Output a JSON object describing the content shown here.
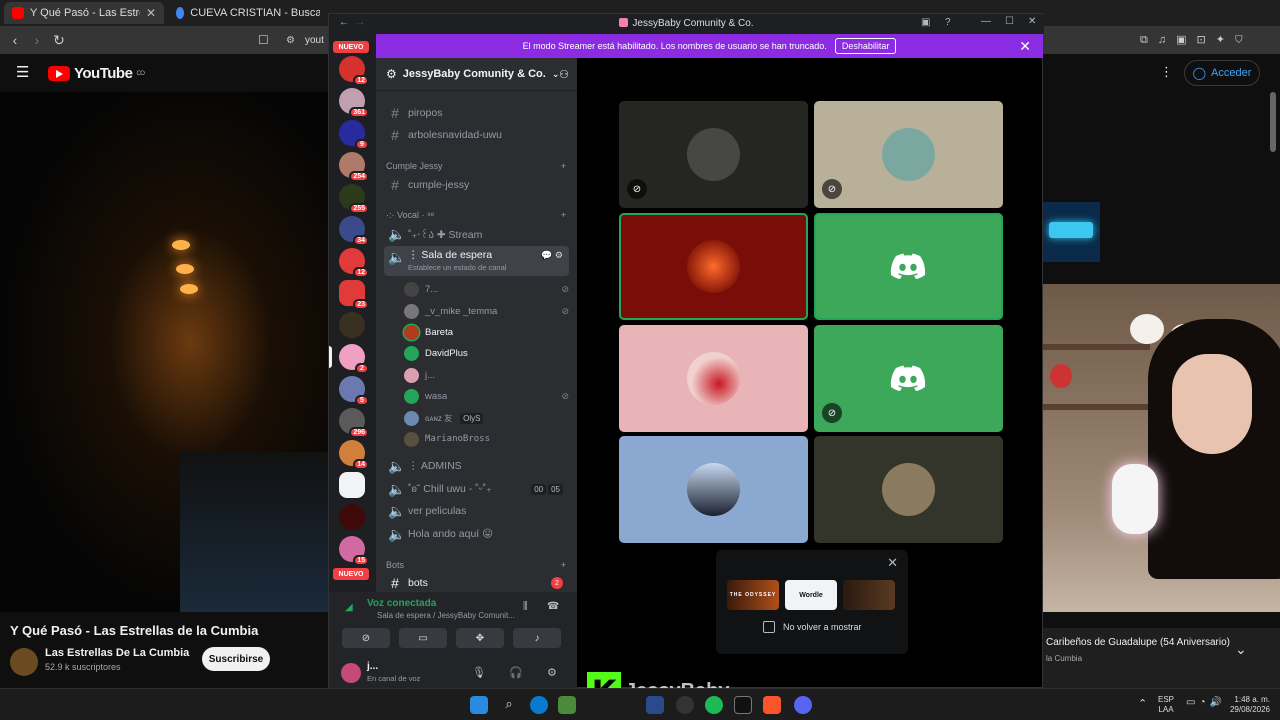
{
  "browser": {
    "tabs": [
      {
        "title": "Y Qué Pasó - Las Estrellas de",
        "close": "✕"
      },
      {
        "title": "CUEVA CRISTIAN - Buscar con Googl",
        "close": "✕"
      }
    ],
    "url": "yout",
    "accent": "#ff0000"
  },
  "youtube": {
    "logo": "YouTube",
    "region": "CO",
    "signin": "Acceder",
    "video_title": "Y Qué Pasó - Las Estrellas de la Cumbia",
    "channel": "Las Estrellas De La Cumbia",
    "subscribers": "52.9 k suscriptores",
    "subscribe": "Suscribirse",
    "rec_title": "Caribeños de Guadalupe (54 Aniversario)",
    "rec_sub": "la Cumbia"
  },
  "discord": {
    "window_title": "JessyBaby Comunity & Co.",
    "streamer_banner": "El modo Streamer está habilitado. Los nombres de usuario se han truncado.",
    "disable": "Deshabilitar",
    "guild_name": "JessyBaby Comunity & Co.",
    "guild_badges": [
      "12",
      "361",
      "9",
      "254",
      "255",
      "34",
      "12",
      "23",
      "",
      "2",
      "5",
      "296",
      "14",
      "",
      "",
      "15"
    ],
    "nuevo": "NUEVO",
    "channels_top": [
      "piropos",
      "arbolesnavidad-uwu"
    ],
    "cat_cumple": "Cumple Jessy",
    "cumple_channel": "cumple-jessy",
    "cat_vocal": "·:· Vocal · ⁹ᵉ",
    "stream_channel": "˚₊‧꒰ა ✚ Stream",
    "sala": "⋮ Sala de espera",
    "sala_status": "Establece un estado de canal",
    "voice_users": [
      {
        "name": "7...",
        "muted": true,
        "color": "#444"
      },
      {
        "name": "_v_mike _temma",
        "muted": true,
        "color": "#777"
      },
      {
        "name": "Bareta",
        "muted": false,
        "color": "#b33a1a"
      },
      {
        "name": "DavidPlus",
        "muted": false,
        "color": "#23a55a"
      },
      {
        "name": "j...",
        "muted": false,
        "color": "#d9a0b0"
      },
      {
        "name": "wasa",
        "muted": true,
        "color": "#23a55a"
      },
      {
        "name": "ɢᴀɴᴢ 友",
        "muted": false,
        "color": "#6a8ab0"
      },
      {
        "name": "MarianoBross",
        "muted": false,
        "color": "#5a5040"
      }
    ],
    "ganz_tag": "OlyS",
    "admins": "⋮ ADMINS",
    "chill": "˚ʚ˘ Chill uwu - ˚ᵕ˚₊",
    "chill_count_a": "00",
    "chill_count_b": "05",
    "ver_peliculas": "ver peliculas",
    "hola": "Hola ando aquí 😛",
    "cat_bots": "Bots",
    "bots_channel": "bots",
    "bots_badge": "2",
    "voice_connected": "Voz conectada",
    "voice_location": "Sala de espera / JessyBaby Comunit...",
    "me_name": "j...",
    "me_status": "En canal de voz",
    "picker_items": [
      "THE ODYSSEY",
      "Wordle",
      ""
    ],
    "dont_show": "No volver a mostrar"
  },
  "overlay": {
    "kick": "K",
    "name": "JessyBaby"
  },
  "taskbar": {
    "lang": "ESP",
    "lang2": "LAA",
    "time": "1:48 a. m.",
    "date": "29/08/2026"
  }
}
